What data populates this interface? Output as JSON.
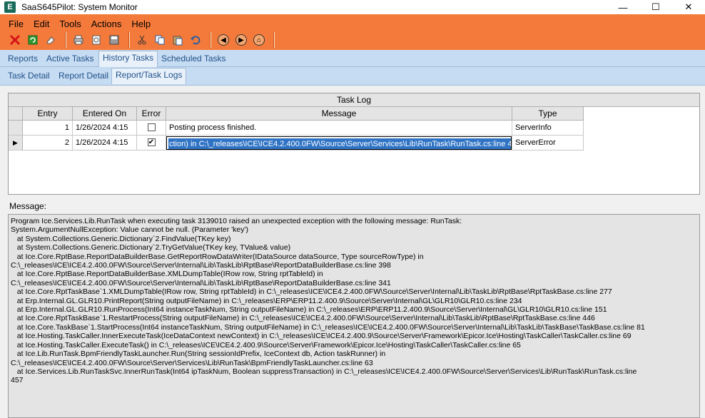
{
  "window": {
    "icon_letter": "E",
    "title": "SaaS645Pilot: System Monitor",
    "minimize": "—",
    "maximize": "☐",
    "close": "✕"
  },
  "menu": [
    "File",
    "Edit",
    "Tools",
    "Actions",
    "Help"
  ],
  "toolbar_icons": [
    "close-icon",
    "refresh-icon",
    "eraser-icon",
    "print-icon",
    "print-preview-icon",
    "save-icon",
    "cut-icon",
    "copy-icon",
    "paste-icon",
    "undo-icon",
    "back-icon",
    "forward-icon",
    "home-icon"
  ],
  "tabs_primary": [
    {
      "label": "Reports",
      "active": false
    },
    {
      "label": "Active Tasks",
      "active": false
    },
    {
      "label": "History Tasks",
      "active": true
    },
    {
      "label": "Scheduled Tasks",
      "active": false
    }
  ],
  "tabs_secondary": [
    {
      "label": "Task Detail",
      "active": false
    },
    {
      "label": "Report Detail",
      "active": false
    },
    {
      "label": "Report/Task Logs",
      "active": true
    }
  ],
  "task_log": {
    "title": "Task Log",
    "columns": [
      "Entry",
      "Entered On",
      "Error",
      "Message",
      "Type"
    ],
    "rows": [
      {
        "entry": "1",
        "entered_on": "1/26/2024 4:15",
        "error": false,
        "message": "Posting process finished.",
        "type": "ServerInfo"
      },
      {
        "entry": "2",
        "entered_on": "1/26/2024 4:15",
        "error": true,
        "message": "ction) in C:\\_releases\\ICE\\ICE4.2.400.0FW\\Source\\Server\\Services\\Lib\\RunTask\\RunTask.cs:line 457",
        "type": "ServerError"
      }
    ]
  },
  "message_panel": {
    "label": "Message:",
    "text": "Program Ice.Services.Lib.RunTask when executing task 3139010 raised an unexpected exception with the following message: RunTask:\nSystem.ArgumentNullException: Value cannot be null. (Parameter 'key')\n   at System.Collections.Generic.Dictionary`2.FindValue(TKey key)\n   at System.Collections.Generic.Dictionary`2.TryGetValue(TKey key, TValue& value)\n   at Ice.Core.RptBase.ReportDataBuilderBase.GetReportRowDataWriter(IDataSource dataSource, Type sourceRowType) in\nC:\\_releases\\ICE\\ICE4.2.400.0FW\\Source\\Server\\Internal\\Lib\\TaskLib\\RptBase\\ReportDataBuilderBase.cs:line 398\n   at Ice.Core.RptBase.ReportDataBuilderBase.XMLDumpTable(IRow row, String rptTableId) in\nC:\\_releases\\ICE\\ICE4.2.400.0FW\\Source\\Server\\Internal\\Lib\\TaskLib\\RptBase\\ReportDataBuilderBase.cs:line 341\n   at Ice.Core.RptTaskBase`1.XMLDumpTable(IRow row, String rptTableId) in C:\\_releases\\ICE\\ICE4.2.400.0FW\\Source\\Server\\Internal\\Lib\\TaskLib\\RptBase\\RptTaskBase.cs:line 277\n   at Erp.Internal.GL.GLR10.PrintReport(String outputFileName) in C:\\_releases\\ERP\\ERP11.2.400.9\\Source\\Server\\Internal\\GL\\GLR10\\GLR10.cs:line 234\n   at Erp.Internal.GL.GLR10.RunProcess(Int64 instanceTaskNum, String outputFileName) in C:\\_releases\\ERP\\ERP11.2.400.9\\Source\\Server\\Internal\\GL\\GLR10\\GLR10.cs:line 151\n   at Ice.Core.RptTaskBase`1.RestartProcess(String outputFileName) in C:\\_releases\\ICE\\ICE4.2.400.0FW\\Source\\Server\\Internal\\Lib\\TaskLib\\RptBase\\RptTaskBase.cs:line 446\n   at Ice.Core.TaskBase`1.StartProcess(Int64 instanceTaskNum, String outputFileName) in C:\\_releases\\ICE\\ICE4.2.400.0FW\\Source\\Server\\Internal\\Lib\\TaskLib\\TaskBase\\TaskBase.cs:line 81\n   at Ice.Hosting.TaskCaller.InnerExecuteTask(IceDataContext newContext) in C:\\_releases\\ICE\\ICE4.2.400.9\\Source\\Server\\Framework\\Epicor.Ice\\Hosting\\TaskCaller\\TaskCaller.cs:line 69\n   at Ice.Hosting.TaskCaller.ExecuteTask() in C:\\_releases\\ICE\\ICE4.2.400.9\\Source\\Server\\Framework\\Epicor.Ice\\Hosting\\TaskCaller\\TaskCaller.cs:line 65\n   at Ice.Lib.RunTask.BpmFriendlyTaskLauncher.Run(String sessionIdPrefix, IceContext db, Action taskRunner) in\nC:\\_releases\\ICE\\ICE4.2.400.0FW\\Source\\Server\\Services\\Lib\\RunTask\\BpmFriendlyTaskLauncher.cs:line 63\n   at Ice.Services.Lib.RunTaskSvc.InnerRunTask(Int64 ipTaskNum, Boolean suppressTransaction) in C:\\_releases\\ICE\\ICE4.2.400.0FW\\Source\\Server\\Services\\Lib\\RunTask\\RunTask.cs:line\n457"
  },
  "colors": {
    "header_orange": "#f47a3b",
    "tab_blue": "#c6dcf2",
    "selection_blue": "#2f73c5"
  }
}
